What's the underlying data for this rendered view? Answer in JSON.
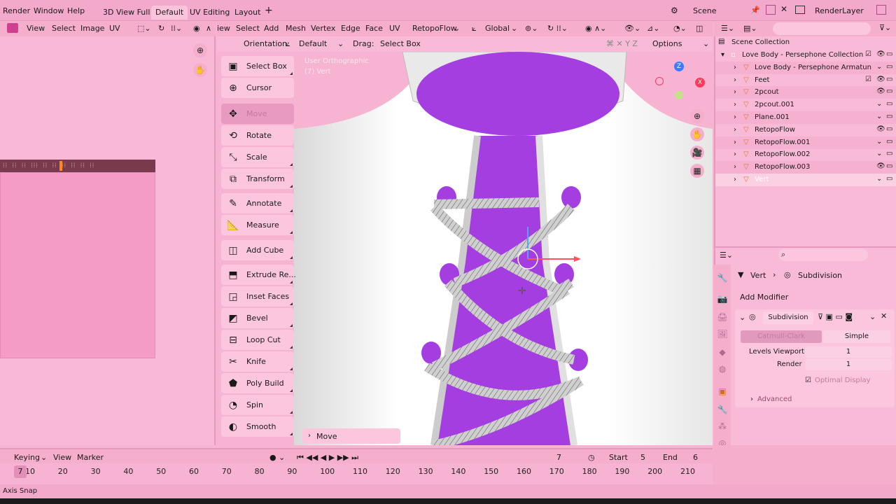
{
  "topbar": {
    "menus": [
      "Render",
      "Window",
      "Help"
    ],
    "workspaces": [
      "3D View Full",
      "Default",
      "UV Editing",
      "Layout"
    ],
    "active_workspace": "Default",
    "add_tab": "+",
    "scene": "Scene",
    "view_layer": "RenderLayer"
  },
  "uv_editor": {
    "menus": [
      "View",
      "Select",
      "Image",
      "UV"
    ],
    "ruler_text": "⁞⁞ ⁞⁞ ⁞⁞ ⁞⁞⁞ ⁞⁞ ⁞⁞ ⁞⁞ ⁞⁞ ⁞⁞ ⁞⁞"
  },
  "viewport_header": {
    "menus": [
      "iew",
      "Select",
      "Add",
      "Mesh",
      "Vertex",
      "Edge",
      "Face",
      "UV"
    ],
    "addon_menu": "RetopoFlow",
    "transform_orientation": "Global",
    "orientation_label": "Orientation:",
    "orientation_value": "Default",
    "drag_label": "Drag:",
    "drag_value": "Select Box",
    "options_label": "Options"
  },
  "viewport_overlay": {
    "view_name": "User Orthographic",
    "object_info": "(7) Vert",
    "operator_panel": "Move"
  },
  "toolbar": {
    "tools": [
      {
        "label": "Select Box",
        "icon": "▣"
      },
      {
        "label": "Cursor",
        "icon": "⊕"
      },
      {
        "label": "Move",
        "icon": "✥"
      },
      {
        "label": "Rotate",
        "icon": "⟲"
      },
      {
        "label": "Scale",
        "icon": "⤡"
      },
      {
        "label": "Transform",
        "icon": "⧉"
      },
      {
        "label": "Annotate",
        "icon": "✎"
      },
      {
        "label": "Measure",
        "icon": "📐"
      },
      {
        "label": "Add Cube",
        "icon": "◫"
      },
      {
        "label": "Extrude Re...",
        "icon": "⬒"
      },
      {
        "label": "Inset Faces",
        "icon": "◲"
      },
      {
        "label": "Bevel",
        "icon": "◩"
      },
      {
        "label": "Loop Cut",
        "icon": "⊟"
      },
      {
        "label": "Knife",
        "icon": "✂"
      },
      {
        "label": "Poly Build",
        "icon": "⬟"
      },
      {
        "label": "Spin",
        "icon": "◔"
      },
      {
        "label": "Smooth",
        "icon": "◐"
      }
    ],
    "active_tool": "Move"
  },
  "outliner": {
    "title": "Scene Collection",
    "rows": [
      {
        "name": "Love Body - Persephone Collection",
        "indent": 1,
        "checked": true
      },
      {
        "name": "Love Body - Persephone Armatun",
        "indent": 2
      },
      {
        "name": "Feet",
        "indent": 2,
        "checked": true
      },
      {
        "name": "2pcout",
        "indent": 2
      },
      {
        "name": "2pcout.001",
        "indent": 2
      },
      {
        "name": "Plane.001",
        "indent": 2
      },
      {
        "name": "RetopoFlow",
        "indent": 2
      },
      {
        "name": "RetopoFlow.001",
        "indent": 2
      },
      {
        "name": "RetopoFlow.002",
        "indent": 2
      },
      {
        "name": "RetopoFlow.003",
        "indent": 2
      },
      {
        "name": "Vert",
        "indent": 2
      }
    ]
  },
  "properties": {
    "breadcrumb_object": "Vert",
    "breadcrumb_modifier": "Subdivision",
    "add_modifier": "Add Modifier",
    "modifier_name": "Subdivision",
    "mode_catmull": "Catmull-Clark",
    "mode_simple": "Simple",
    "levels_viewport_label": "Levels Viewport",
    "levels_viewport_value": "1",
    "render_label": "Render",
    "render_value": "1",
    "optimal_display": "Optimal Display",
    "advanced": "Advanced"
  },
  "timeline": {
    "menus": [
      "Keying",
      "View",
      "Marker"
    ],
    "current_frame": "7",
    "start_label": "Start",
    "start_value": "5",
    "end_label": "End",
    "end_value": "6",
    "ruler_ticks": [
      "10",
      "20",
      "30",
      "40",
      "50",
      "60",
      "70",
      "80",
      "90",
      "100",
      "110",
      "120",
      "130",
      "140",
      "150",
      "160",
      "170",
      "180",
      "190",
      "200",
      "210"
    ],
    "playhead_label": "7"
  },
  "statusbar": {
    "text": "Axis Snap"
  }
}
